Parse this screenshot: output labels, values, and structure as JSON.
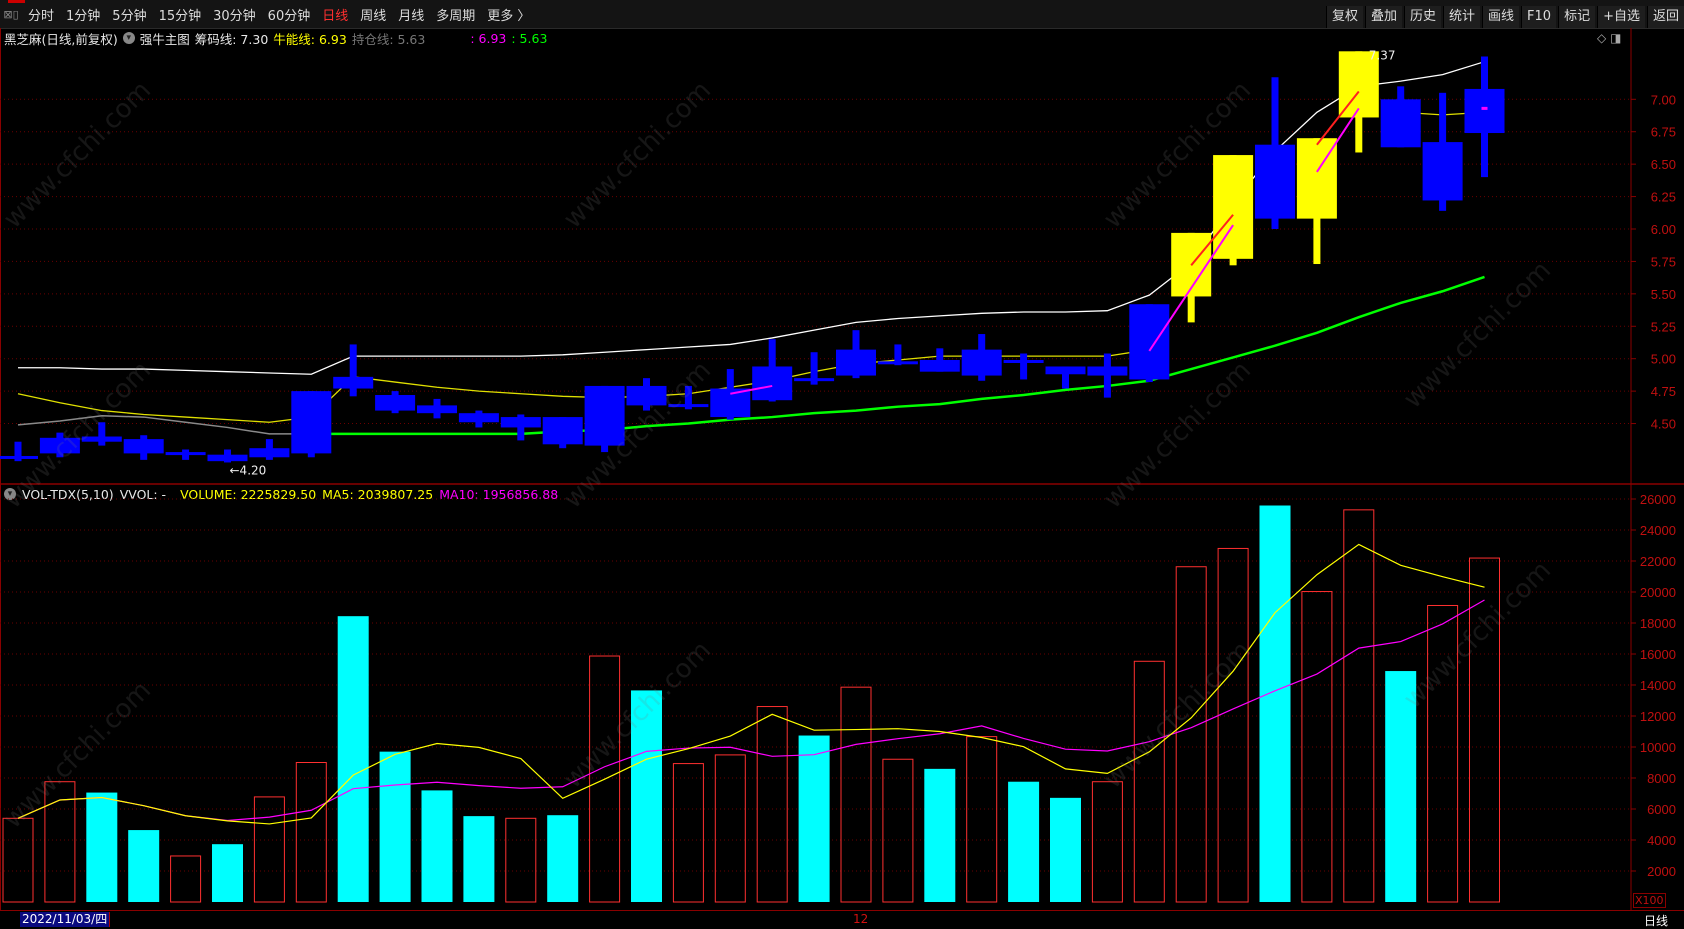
{
  "toolbar": {
    "periods": [
      "分时",
      "1分钟",
      "5分钟",
      "15分钟",
      "30分钟",
      "60分钟",
      "日线",
      "周线",
      "月线",
      "多周期",
      "更多 〉"
    ],
    "active_period": "日线",
    "buttons": [
      "复权",
      "叠加",
      "历史",
      "统计",
      "画线",
      "F10",
      "标记",
      "+自选",
      "返回"
    ]
  },
  "info": {
    "stock": "黑芝麻(日线,前复权)",
    "indicator": "强牛主图",
    "chip_line": "筹码线: 7.30",
    "bull_line": "牛能线: 6.93",
    "hold_line": "持仓线: 5.63",
    "extra1": ": 6.93",
    "extra2": ": 5.63"
  },
  "vol_info": {
    "name": "VOL-TDX(5,10)",
    "vvol": "VVOL: -",
    "volume": "VOLUME: 2225829.50",
    "ma5": "MA5: 2039807.25",
    "ma10": "MA10: 1956856.88"
  },
  "colors": {
    "up_candle": "#ffff00",
    "down_candle": "#0000ff",
    "vol_up": "#ff3030",
    "vol_down": "#00ffff",
    "ma5": "#ffff00",
    "ma10": "#ff00ff",
    "green_line": "#00ff00",
    "white_line": "#ffffff",
    "gray_line": "#8a8a8a",
    "axis": "#c01010"
  },
  "chart_data": {
    "type": "candlestick",
    "price_axis": {
      "ticks": [
        "7.00",
        "6.75",
        "6.50",
        "6.25",
        "6.00",
        "5.75",
        "5.50",
        "5.25",
        "5.00",
        "4.75",
        "4.50"
      ],
      "ylim": [
        4.15,
        7.45
      ]
    },
    "high_label": "7.37",
    "low_label": "←4.20",
    "candles": [
      {
        "o": 4.25,
        "c": 4.25,
        "h": 4.36,
        "l": 4.21,
        "color": "blue"
      },
      {
        "o": 4.39,
        "c": 4.27,
        "h": 4.43,
        "l": 4.24,
        "color": "blue"
      },
      {
        "o": 4.4,
        "c": 4.36,
        "h": 4.51,
        "l": 4.33,
        "color": "blue"
      },
      {
        "o": 4.38,
        "c": 4.27,
        "h": 4.41,
        "l": 4.22,
        "color": "blue"
      },
      {
        "o": 4.28,
        "c": 4.28,
        "h": 4.3,
        "l": 4.22,
        "color": "blue"
      },
      {
        "o": 4.26,
        "c": 4.21,
        "h": 4.3,
        "l": 4.2,
        "color": "blue"
      },
      {
        "o": 4.31,
        "c": 4.24,
        "h": 4.38,
        "l": 4.22,
        "color": "blue"
      },
      {
        "o": 4.75,
        "c": 4.27,
        "h": 4.75,
        "l": 4.24,
        "color": "blue"
      },
      {
        "o": 4.86,
        "c": 4.77,
        "h": 5.11,
        "l": 4.71,
        "color": "blue"
      },
      {
        "o": 4.72,
        "c": 4.6,
        "h": 4.75,
        "l": 4.58,
        "color": "blue"
      },
      {
        "o": 4.64,
        "c": 4.58,
        "h": 4.69,
        "l": 4.54,
        "color": "blue"
      },
      {
        "o": 4.58,
        "c": 4.51,
        "h": 4.6,
        "l": 4.47,
        "color": "blue"
      },
      {
        "o": 4.55,
        "c": 4.47,
        "h": 4.57,
        "l": 4.37,
        "color": "blue"
      },
      {
        "o": 4.55,
        "c": 4.34,
        "h": 4.55,
        "l": 4.31,
        "color": "blue"
      },
      {
        "o": 4.79,
        "c": 4.33,
        "h": 4.79,
        "l": 4.28,
        "color": "blue"
      },
      {
        "o": 4.79,
        "c": 4.64,
        "h": 4.85,
        "l": 4.6,
        "color": "blue"
      },
      {
        "o": 4.65,
        "c": 4.65,
        "h": 4.79,
        "l": 4.61,
        "color": "blue"
      },
      {
        "o": 4.77,
        "c": 4.55,
        "h": 4.92,
        "l": 4.53,
        "color": "blue"
      },
      {
        "o": 4.94,
        "c": 4.68,
        "h": 5.15,
        "l": 4.67,
        "color": "blue"
      },
      {
        "o": 4.85,
        "c": 4.85,
        "h": 5.05,
        "l": 4.8,
        "color": "blue"
      },
      {
        "o": 5.07,
        "c": 4.87,
        "h": 5.22,
        "l": 4.85,
        "color": "blue"
      },
      {
        "o": 4.98,
        "c": 4.98,
        "h": 5.11,
        "l": 4.95,
        "color": "blue"
      },
      {
        "o": 4.99,
        "c": 4.9,
        "h": 5.08,
        "l": 4.9,
        "color": "blue"
      },
      {
        "o": 5.07,
        "c": 4.87,
        "h": 5.19,
        "l": 4.83,
        "color": "blue"
      },
      {
        "o": 4.99,
        "c": 4.99,
        "h": 5.04,
        "l": 4.84,
        "color": "blue"
      },
      {
        "o": 4.94,
        "c": 4.88,
        "h": 4.94,
        "l": 4.77,
        "color": "blue"
      },
      {
        "o": 4.94,
        "c": 4.87,
        "h": 5.04,
        "l": 4.7,
        "color": "blue"
      },
      {
        "o": 5.42,
        "c": 4.84,
        "h": 5.42,
        "l": 4.82,
        "color": "blue"
      },
      {
        "o": 5.48,
        "c": 5.97,
        "h": 5.97,
        "l": 5.28,
        "color": "yellow"
      },
      {
        "o": 5.77,
        "c": 6.57,
        "h": 6.57,
        "l": 5.72,
        "color": "yellow"
      },
      {
        "o": 6.65,
        "c": 6.08,
        "h": 7.17,
        "l": 6.0,
        "color": "blue"
      },
      {
        "o": 6.08,
        "c": 6.7,
        "h": 6.7,
        "l": 5.73,
        "color": "yellow"
      },
      {
        "o": 6.86,
        "c": 7.37,
        "h": 7.37,
        "l": 6.59,
        "color": "yellow"
      },
      {
        "o": 7.0,
        "c": 6.63,
        "h": 7.1,
        "l": 6.63,
        "color": "blue"
      },
      {
        "o": 6.67,
        "c": 6.22,
        "h": 7.05,
        "l": 6.14,
        "color": "blue"
      },
      {
        "o": 7.08,
        "c": 6.74,
        "h": 7.33,
        "l": 6.4,
        "color": "blue"
      }
    ],
    "lines": {
      "white": [
        4.93,
        4.93,
        4.92,
        4.92,
        4.91,
        4.9,
        4.89,
        4.88,
        5.02,
        5.02,
        5.02,
        5.02,
        5.02,
        5.03,
        5.05,
        5.07,
        5.09,
        5.11,
        5.16,
        5.22,
        5.28,
        5.31,
        5.33,
        5.35,
        5.36,
        5.36,
        5.37,
        5.49,
        5.74,
        6.2,
        6.6,
        6.9,
        7.1,
        7.14,
        7.19,
        7.29
      ],
      "yellow": [
        4.73,
        4.66,
        4.6,
        4.57,
        4.55,
        4.53,
        4.51,
        4.55,
        4.86,
        4.82,
        4.78,
        4.75,
        4.73,
        4.71,
        4.7,
        4.71,
        4.73,
        4.78,
        4.83,
        4.9,
        4.96,
        4.99,
        5.02,
        5.02,
        5.02,
        5.02,
        5.02,
        5.07,
        null,
        null,
        null,
        null,
        null,
        6.9,
        6.88,
        6.9
      ],
      "gray": [
        4.49,
        4.52,
        4.56,
        4.55,
        4.51,
        4.47,
        4.42,
        4.42
      ],
      "green": [
        null,
        null,
        null,
        null,
        null,
        null,
        null,
        4.42,
        4.42,
        4.42,
        4.42,
        4.42,
        4.42,
        4.44,
        4.45,
        4.48,
        4.5,
        4.53,
        4.55,
        4.58,
        4.6,
        4.63,
        4.65,
        4.69,
        4.72,
        4.76,
        4.79,
        4.83,
        4.92,
        5.01,
        5.1,
        5.2,
        5.32,
        5.43,
        5.52,
        5.63
      ]
    },
    "segments": [
      {
        "from": 17,
        "p1": 4.73,
        "to": 18,
        "p2": 4.79,
        "color": "#ff00ff"
      },
      {
        "from": 27,
        "p1": 5.06,
        "to": 29,
        "p2": 6.03,
        "color": "#ff00ff"
      },
      {
        "from": 28,
        "p1": 5.72,
        "to": 29,
        "p2": 6.11,
        "color": "#ff2020"
      },
      {
        "from": 31,
        "p1": 6.44,
        "to": 32,
        "p2": 6.93,
        "color": "#ff00ff"
      },
      {
        "from": 31,
        "p1": 6.65,
        "to": 32,
        "p2": 7.06,
        "color": "#ff2020"
      }
    ],
    "volume": {
      "unit_label": "X100",
      "ticks": [
        "26000",
        "24000",
        "22000",
        "20000",
        "18000",
        "16000",
        "14000",
        "12000",
        "10000",
        "8000",
        "6000",
        "4000",
        "2000"
      ],
      "ylim": [
        0,
        26000
      ],
      "values": [
        5400,
        7760,
        7060,
        4640,
        2970,
        3730,
        6780,
        9000,
        18440,
        9700,
        7200,
        5540,
        5400,
        5600,
        15870,
        13650,
        8930,
        9490,
        12610,
        10740,
        13860,
        9210,
        8590,
        10670,
        7760,
        6720,
        7760,
        15530,
        21630,
        22810,
        25580,
        20030,
        25300,
        14900,
        19130,
        22190
      ],
      "dir": [
        "up",
        "up",
        "down",
        "down",
        "up",
        "down",
        "up",
        "up",
        "down",
        "down",
        "down",
        "down",
        "up",
        "down",
        "up",
        "down",
        "up",
        "up",
        "up",
        "down",
        "up",
        "up",
        "down",
        "up",
        "down",
        "down",
        "up",
        "up",
        "up",
        "up",
        "down",
        "up",
        "up",
        "down",
        "up",
        "up"
      ]
    }
  },
  "datebar": {
    "selected_date": "2022/11/03/四",
    "month_mark": "12",
    "period": "日线"
  },
  "watermark": "www.cfchi.com"
}
